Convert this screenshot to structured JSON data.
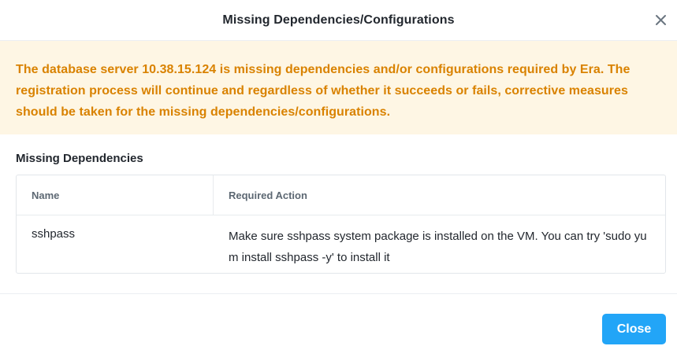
{
  "dialog": {
    "title": "Missing Dependencies/Configurations",
    "close_icon": "close-icon"
  },
  "warning": {
    "message": "The database server 10.38.15.124 is missing dependencies and/or configurations required by Era. The registration process will continue and regardless of whether it succeeds or fails, corrective measures should be taken for the missing dependencies/configurations.",
    "color": "#d98200",
    "background": "#fef6e4"
  },
  "dependencies": {
    "section_title": "Missing Dependencies",
    "columns": [
      "Name",
      "Required Action"
    ],
    "rows": [
      {
        "name": "sshpass",
        "action": "Make sure sshpass system package is installed on the VM. You can try 'sudo yum install sshpass -y' to install it"
      }
    ]
  },
  "footer": {
    "close_label": "Close",
    "accent_color": "#22a5f7"
  }
}
